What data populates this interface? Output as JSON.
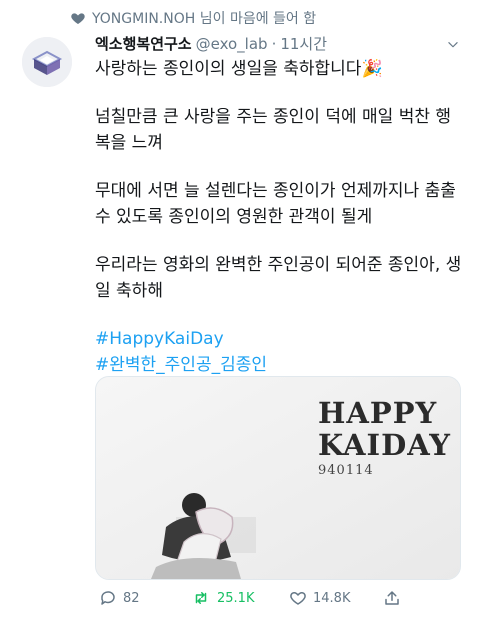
{
  "social_context": {
    "text": "YONGMIN.NOH 님이 마음에 들어 함",
    "icon": "heart-icon"
  },
  "tweet": {
    "display_name": "엑소행복연구소",
    "handle": "@exo_lab",
    "separator": "·",
    "time": "11시간",
    "lines": [
      "사랑하는 종인이의 생일을 축하합니다🎉",
      "넘칠만큼 큰 사랑을 주는 종인이 덕에 매일 벅찬 행복을 느껴",
      "무대에 서면 늘 설렌다는 종인이가 언제까지나 춤출 수 있도록 종인이의 영원한 관객이 될게",
      "우리라는 영화의 완벽한 주인공이 되어준 종인아, 생일 축하해"
    ],
    "hashtags": [
      "#HappyKaiDay",
      "#완벽한_주인공_김종인"
    ]
  },
  "media": {
    "title_line1": "HAPPY",
    "title_line2": "KAIDAY",
    "date_text": "940114"
  },
  "actions": {
    "reply_count": "82",
    "retweet_count": "25.1K",
    "like_count": "14.8K"
  },
  "colors": {
    "accent": "#1da1f2",
    "retweet": "#17bf63",
    "muted": "#657786"
  }
}
